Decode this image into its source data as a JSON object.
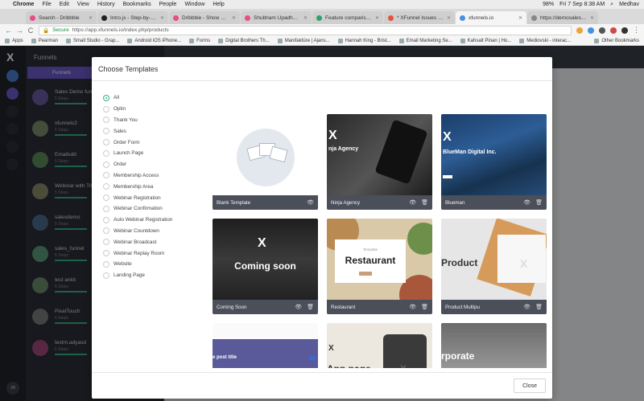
{
  "menubar": {
    "apple": "",
    "app": "Chrome",
    "items": [
      "File",
      "Edit",
      "View",
      "History",
      "Bookmarks",
      "People",
      "Window",
      "Help"
    ],
    "battery": "98%",
    "clock": "Fri 7 Sep  8:38 AM",
    "user": "Medhav"
  },
  "tabs": [
    {
      "label": "Search - Dribbble",
      "color": "#ea4c89",
      "active": false
    },
    {
      "label": "Intro.js - Step-by-step",
      "color": "#222222",
      "active": false
    },
    {
      "label": "Dribbble - Show and tell",
      "color": "#ea4c89",
      "active": false
    },
    {
      "label": "Shubham Upadhyay | Li",
      "color": "#ea4c89",
      "active": false
    },
    {
      "label": "Feature comparison sc",
      "color": "#2fa36b",
      "active": false
    },
    {
      "label": "* XFunnel Issues | Trello",
      "color": "#e5533c",
      "active": false
    },
    {
      "label": "xfunnels.io",
      "color": "#4a90e2",
      "active": true
    },
    {
      "label": "https://demosales.xfu",
      "color": "#888888",
      "active": false
    }
  ],
  "address": {
    "back": "←",
    "forward": "→",
    "reload": "C",
    "secure": "Secure",
    "url": "https://app.xfunnels.io/index.php/products"
  },
  "bookmarks": [
    "Apps",
    "Pearman",
    "Small Studio - Grap...",
    "Android iOS iPhone...",
    "Forms",
    "Digital Brothers Th...",
    "Manifaktūre | Ajans...",
    "Hannah King - Brist...",
    "Email Marketing Se...",
    "Kahsalt Pinan | Ho...",
    "Mediovski - interac..."
  ],
  "bookmarks_other": "Other Bookmarks",
  "background": {
    "logo": "X",
    "panel_title": "Funnels",
    "panel_tab": "Funnels",
    "avatar": "JR",
    "funnels": [
      {
        "name": "Sales Demo funnel",
        "steps": "5 Steps",
        "color": "#6b5aa0"
      },
      {
        "name": "xfunnels2",
        "steps": "5 Steps",
        "color": "#7c8a6a"
      },
      {
        "name": "Emailsdd",
        "steps": "5 Steps",
        "color": "#5a8a5a"
      },
      {
        "name": "Webinar with Tri",
        "steps": "5 Steps",
        "color": "#8a8a6a"
      },
      {
        "name": "salesdemo",
        "steps": "5 Steps",
        "color": "#4a6a8a"
      },
      {
        "name": "sales_funnel",
        "steps": "5 Steps",
        "color": "#5a9a7a"
      },
      {
        "name": "test ankit",
        "steps": "5 Steps",
        "color": "#6a8a6a"
      },
      {
        "name": "PixalTouch",
        "steps": "5 Steps",
        "color": "#7a7a7a"
      },
      {
        "name": "testrn.adyasd",
        "steps": "5 Steps",
        "color": "#a04a7a"
      }
    ]
  },
  "modal": {
    "title": "Choose Templates",
    "close_label": "Close",
    "categories": [
      "All",
      "Optin",
      "Thank You",
      "Sales",
      "Order Form",
      "Launch Page",
      "Order",
      "Membership Access",
      "Membership Area",
      "Webinar Registration",
      "Webinar Confirmation",
      "Auto Webinar Registration",
      "Webinar Countdown",
      "Webinar Broadcast",
      "Webinar Replay Room",
      "Website",
      "Landing Page"
    ],
    "selected_category": "All",
    "templates": [
      {
        "name": "Blank Template",
        "thumb_text": "",
        "thumb_sub": "",
        "view_icon": "eye-icon",
        "delete_icon": ""
      },
      {
        "name": "Ninja Agency",
        "thumb_text": "nja Agency",
        "thumb_sub": "",
        "view_icon": "eye-icon",
        "delete_icon": "trash-icon"
      },
      {
        "name": "Blueman",
        "thumb_text": "BlueMan Digital Inc.",
        "thumb_sub": "",
        "view_icon": "eye-icon",
        "delete_icon": "trash-icon"
      },
      {
        "name": "Coming Soon",
        "thumb_text": "Coming soon",
        "thumb_sub": "",
        "view_icon": "eye-icon",
        "delete_icon": "trash-icon"
      },
      {
        "name": "Restaurant",
        "thumb_text": "Restaurant",
        "thumb_sub": "Template",
        "view_icon": "eye-icon",
        "delete_icon": "trash-icon"
      },
      {
        "name": "Product Multipu",
        "thumb_text": "Product",
        "thumb_sub": "",
        "view_icon": "eye-icon",
        "delete_icon": "trash-icon"
      },
      {
        "name": "",
        "thumb_text": "e post title",
        "thumb_sub": "",
        "view_icon": "",
        "delete_icon": ""
      },
      {
        "name": "",
        "thumb_text": "App page",
        "thumb_sub": "",
        "view_icon": "",
        "delete_icon": ""
      },
      {
        "name": "",
        "thumb_text": "rporate",
        "thumb_sub": "",
        "view_icon": "",
        "delete_icon": ""
      }
    ]
  },
  "colors": {
    "accent": "#6a5ac8",
    "success": "#36b37e",
    "card_footer": "#4a4f5a"
  }
}
